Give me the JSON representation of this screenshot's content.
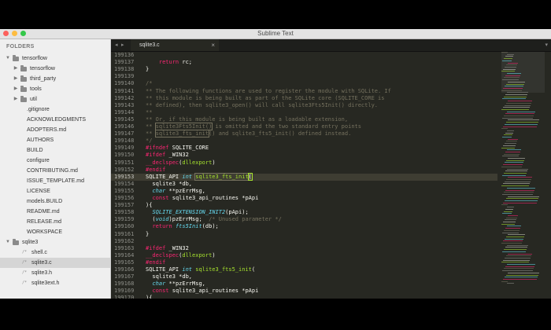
{
  "window": {
    "title": "Sublime Text"
  },
  "sidebar": {
    "header": "FOLDERS",
    "items": [
      {
        "type": "folder",
        "label": "tensorflow",
        "depth": 0,
        "open": true
      },
      {
        "type": "folder",
        "label": "tensorflow",
        "depth": 1,
        "open": false
      },
      {
        "type": "folder",
        "label": "third_party",
        "depth": 1,
        "open": false
      },
      {
        "type": "folder",
        "label": "tools",
        "depth": 1,
        "open": false
      },
      {
        "type": "folder",
        "label": "util",
        "depth": 1,
        "open": false
      },
      {
        "type": "file",
        "label": ".gitignore",
        "depth": 1,
        "ext": ""
      },
      {
        "type": "file",
        "label": "ACKNOWLEDGMENTS",
        "depth": 1,
        "ext": ""
      },
      {
        "type": "file",
        "label": "ADOPTERS.md",
        "depth": 1,
        "ext": ""
      },
      {
        "type": "file",
        "label": "AUTHORS",
        "depth": 1,
        "ext": ""
      },
      {
        "type": "file",
        "label": "BUILD",
        "depth": 1,
        "ext": ""
      },
      {
        "type": "file",
        "label": "configure",
        "depth": 1,
        "ext": ""
      },
      {
        "type": "file",
        "label": "CONTRIBUTING.md",
        "depth": 1,
        "ext": ""
      },
      {
        "type": "file",
        "label": "ISSUE_TEMPLATE.md",
        "depth": 1,
        "ext": ""
      },
      {
        "type": "file",
        "label": "LICENSE",
        "depth": 1,
        "ext": ""
      },
      {
        "type": "file",
        "label": "models.BUILD",
        "depth": 1,
        "ext": ""
      },
      {
        "type": "file",
        "label": "README.md",
        "depth": 1,
        "ext": ""
      },
      {
        "type": "file",
        "label": "RELEASE.md",
        "depth": 1,
        "ext": ""
      },
      {
        "type": "file",
        "label": "WORKSPACE",
        "depth": 1,
        "ext": ""
      },
      {
        "type": "folder",
        "label": "sqlite3",
        "depth": 0,
        "open": true
      },
      {
        "type": "file",
        "label": "shell.c",
        "depth": 1,
        "ext": "/*"
      },
      {
        "type": "file",
        "label": "sqlite3.c",
        "depth": 1,
        "ext": "/*",
        "selected": true
      },
      {
        "type": "file",
        "label": "sqlite3.h",
        "depth": 1,
        "ext": "/*"
      },
      {
        "type": "file",
        "label": "sqlite3ext.h",
        "depth": 1,
        "ext": "/*"
      }
    ]
  },
  "tabbar": {
    "back_icon": "◂",
    "forward_icon": "▸",
    "tab": {
      "label": "sqlite3.c",
      "close": "×"
    },
    "dropdown_icon": "▾"
  },
  "editor": {
    "current_line": 199153,
    "lines": [
      {
        "num": "199136",
        "tokens": []
      },
      {
        "num": "199137",
        "tokens": [
          [
            "    ",
            ""
          ],
          [
            "return",
            "c-kw"
          ],
          [
            " rc;",
            ""
          ]
        ]
      },
      {
        "num": "199138",
        "tokens": [
          [
            "}",
            ""
          ]
        ]
      },
      {
        "num": "199139",
        "tokens": []
      },
      {
        "num": "199140",
        "tokens": [
          [
            "/*",
            "c-cm"
          ]
        ]
      },
      {
        "num": "199141",
        "tokens": [
          [
            "** The following functions are used to register the module with SQLite. If",
            "c-cm"
          ]
        ]
      },
      {
        "num": "199142",
        "tokens": [
          [
            "** this module is being built as part of the SQLite core (SQLITE_CORE is",
            "c-cm"
          ]
        ]
      },
      {
        "num": "199143",
        "tokens": [
          [
            "** defined), then sqlite3_open() will call sqlite3Fts5Init() directly.",
            "c-cm"
          ]
        ]
      },
      {
        "num": "199144",
        "tokens": [
          [
            "**",
            "c-cm"
          ]
        ]
      },
      {
        "num": "199145",
        "tokens": [
          [
            "** Or, if this module is being built as a loadable extension,",
            "c-cm"
          ]
        ]
      },
      {
        "num": "199146",
        "tokens": [
          [
            "** ",
            "c-cm"
          ],
          [
            "sqlite3Fts5Init()",
            "c-cm c-hl"
          ],
          [
            " is omitted and the two standard entry points",
            "c-cm"
          ]
        ]
      },
      {
        "num": "199147",
        "tokens": [
          [
            "** ",
            "c-cm"
          ],
          [
            "sqlite3_fts_init",
            "c-cm c-hl"
          ],
          [
            "() and sqlite3_fts5_init() defined instead.",
            "c-cm"
          ]
        ]
      },
      {
        "num": "199148",
        "tokens": [
          [
            "*/",
            "c-cm"
          ]
        ]
      },
      {
        "num": "199149",
        "tokens": [
          [
            "#ifndef",
            "c-kw"
          ],
          [
            " SQLITE_CORE",
            ""
          ]
        ]
      },
      {
        "num": "199150",
        "tokens": [
          [
            "#ifdef",
            "c-kw"
          ],
          [
            " _WIN32",
            ""
          ]
        ]
      },
      {
        "num": "199151",
        "tokens": [
          [
            "__declspec",
            "c-kw"
          ],
          [
            "(",
            ""
          ],
          [
            "dllexport",
            "c-fn"
          ],
          [
            ")",
            ""
          ]
        ]
      },
      {
        "num": "199152",
        "tokens": [
          [
            "#endif",
            "c-kw"
          ]
        ]
      },
      {
        "num": "199153",
        "tokens": [
          [
            "SQLITE_API ",
            ""
          ],
          [
            "int",
            "c-type"
          ],
          [
            " ",
            ""
          ],
          [
            "sqlite3_fts_init",
            "c-fn c-hl"
          ],
          [
            "(",
            "c-sel"
          ]
        ]
      },
      {
        "num": "199154",
        "tokens": [
          [
            "  sqlite3 *db,",
            ""
          ]
        ]
      },
      {
        "num": "199155",
        "tokens": [
          [
            "  ",
            ""
          ],
          [
            "char",
            "c-type"
          ],
          [
            " **pzErrMsg,",
            ""
          ]
        ]
      },
      {
        "num": "199156",
        "tokens": [
          [
            "  ",
            ""
          ],
          [
            "const",
            "c-kw"
          ],
          [
            " sqlite3_api_routines *pApi",
            ""
          ]
        ]
      },
      {
        "num": "199157",
        "tokens": [
          [
            "){",
            ""
          ]
        ]
      },
      {
        "num": "199158",
        "tokens": [
          [
            "  ",
            ""
          ],
          [
            "SQLITE_EXTENSION_INIT2",
            "c-type"
          ],
          [
            "(pApi);",
            ""
          ]
        ]
      },
      {
        "num": "199159",
        "tokens": [
          [
            "  (",
            ""
          ],
          [
            "void",
            "c-type"
          ],
          [
            ")pzErrMsg;  ",
            ""
          ],
          [
            "/* Unused parameter */",
            "c-cm"
          ]
        ]
      },
      {
        "num": "199160",
        "tokens": [
          [
            "  ",
            ""
          ],
          [
            "return",
            "c-kw"
          ],
          [
            " ",
            ""
          ],
          [
            "fts5Init",
            "c-type"
          ],
          [
            "(db);",
            ""
          ]
        ]
      },
      {
        "num": "199161",
        "tokens": [
          [
            "}",
            ""
          ]
        ]
      },
      {
        "num": "199162",
        "tokens": []
      },
      {
        "num": "199163",
        "tokens": [
          [
            "#ifdef",
            "c-kw"
          ],
          [
            " _WIN32",
            ""
          ]
        ]
      },
      {
        "num": "199164",
        "tokens": [
          [
            "__declspec",
            "c-kw"
          ],
          [
            "(",
            ""
          ],
          [
            "dllexport",
            "c-fn"
          ],
          [
            ")",
            ""
          ]
        ]
      },
      {
        "num": "199165",
        "tokens": [
          [
            "#endif",
            "c-kw"
          ]
        ]
      },
      {
        "num": "199166",
        "tokens": [
          [
            "SQLITE_API ",
            ""
          ],
          [
            "int",
            "c-type"
          ],
          [
            " ",
            ""
          ],
          [
            "sqlite3_fts5_init",
            "c-fn"
          ],
          [
            "(",
            ""
          ]
        ]
      },
      {
        "num": "199167",
        "tokens": [
          [
            "  sqlite3 *db,",
            ""
          ]
        ]
      },
      {
        "num": "199168",
        "tokens": [
          [
            "  ",
            ""
          ],
          [
            "char",
            "c-type"
          ],
          [
            " **pzErrMsg,",
            ""
          ]
        ]
      },
      {
        "num": "199169",
        "tokens": [
          [
            "  ",
            ""
          ],
          [
            "const",
            "c-kw"
          ],
          [
            " sqlite3_api_routines *pApi",
            ""
          ]
        ]
      },
      {
        "num": "199170",
        "tokens": [
          [
            "){",
            ""
          ]
        ]
      }
    ]
  },
  "colors": {
    "editor_bg": "#272822",
    "keyword": "#f92672",
    "type": "#66d9ef",
    "function": "#a6e22e",
    "comment": "#75715e",
    "sidebar_bg": "#efefef"
  }
}
